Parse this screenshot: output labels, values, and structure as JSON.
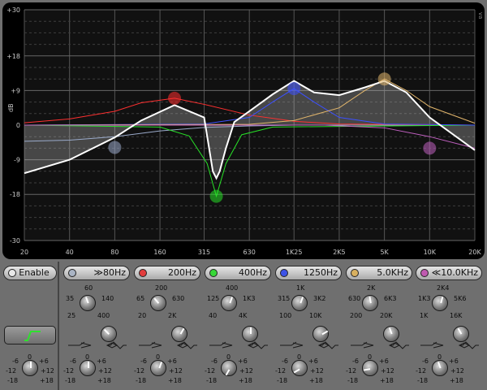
{
  "graph": {
    "y_labels": [
      "+30",
      "+18",
      "+9",
      "dB",
      "0",
      "-9",
      "-18",
      "-30"
    ],
    "x_labels": [
      "20",
      "40",
      "80",
      "160",
      "315",
      "630",
      "1K25",
      "2K5",
      "5K",
      "10K",
      "20K"
    ],
    "corner_label": "va"
  },
  "enable": {
    "label": "Enable"
  },
  "bands": [
    {
      "name": "band-1",
      "led": "#aab4c4",
      "label": "≫80Hz",
      "freq_ticks": [
        "25",
        "35",
        "60",
        "140",
        "400"
      ],
      "selected": "low-shelf"
    },
    {
      "name": "band-2",
      "led": "#e23c3c",
      "label": "200Hz",
      "freq_ticks": [
        "20",
        "65",
        "200",
        "630",
        "2K"
      ],
      "selected": "peak"
    },
    {
      "name": "band-3",
      "led": "#38d838",
      "label": "400Hz",
      "freq_ticks": [
        "40",
        "125",
        "400",
        "1K3",
        "4K"
      ],
      "selected": "peak"
    },
    {
      "name": "band-4",
      "led": "#3c52e6",
      "label": "1250Hz",
      "freq_ticks": [
        "100",
        "315",
        "1K",
        "3K2",
        "10K"
      ],
      "selected": "peak"
    },
    {
      "name": "band-5",
      "led": "#d8b060",
      "label": "5.0KHz",
      "freq_ticks": [
        "200",
        "630",
        "2K",
        "6K3",
        "20K"
      ],
      "selected": "peak"
    },
    {
      "name": "band-6",
      "led": "#c05ab0",
      "label": "≪10.0KHz",
      "freq_ticks": [
        "1K",
        "1K3",
        "2K4",
        "5K6",
        "16K"
      ],
      "selected": "high-shelf"
    }
  ],
  "gain_ticks": [
    "-6",
    "0",
    "+6",
    "-12",
    "+12",
    "-18",
    "+18"
  ],
  "master_gain_ticks": [
    "-6",
    "0",
    "+6",
    "-12",
    "+12",
    "-18",
    "+18"
  ],
  "chart_data": {
    "type": "line",
    "x_ticks": [
      "20",
      "40",
      "80",
      "160",
      "315",
      "630",
      "1K25",
      "2K5",
      "5K",
      "10K",
      "20K"
    ],
    "y_ticks": [
      "+30",
      "+18",
      "+9",
      "0",
      "-9",
      "-18",
      "-30"
    ],
    "y_unit": "dB",
    "xlim_hz": [
      20,
      20000
    ],
    "ylim_db": [
      -30,
      30
    ],
    "x_scale": "log",
    "grid": true,
    "series": [
      {
        "color": "#9aaaca",
        "points": [
          [
            20,
            -4.2
          ],
          [
            40,
            -3.9
          ],
          [
            80,
            -3.0
          ],
          [
            160,
            -1.5
          ],
          [
            315,
            -0.6
          ],
          [
            630,
            -0.2
          ],
          [
            1250,
            0
          ],
          [
            20000,
            0
          ]
        ],
        "handle": [
          80,
          -5.8
        ]
      },
      {
        "color": "#ff3030",
        "points": [
          [
            20,
            0.6
          ],
          [
            40,
            1.6
          ],
          [
            80,
            3.6
          ],
          [
            120,
            5.8
          ],
          [
            200,
            7.0
          ],
          [
            315,
            5.4
          ],
          [
            630,
            2.6
          ],
          [
            1250,
            1.0
          ],
          [
            2500,
            0.3
          ],
          [
            20000,
            0
          ]
        ],
        "handle": [
          200,
          7.0
        ]
      },
      {
        "color": "#28e028",
        "points": [
          [
            20,
            0
          ],
          [
            160,
            -0.5
          ],
          [
            250,
            -2.8
          ],
          [
            330,
            -10
          ],
          [
            380,
            -18.5
          ],
          [
            440,
            -10
          ],
          [
            560,
            -2.5
          ],
          [
            900,
            -0.5
          ],
          [
            20000,
            0
          ]
        ],
        "handle": [
          380,
          -18.5
        ]
      },
      {
        "color": "#3c50ff",
        "points": [
          [
            20,
            0
          ],
          [
            315,
            0.3
          ],
          [
            630,
            2.0
          ],
          [
            900,
            6.0
          ],
          [
            1250,
            9.5
          ],
          [
            1700,
            6.0
          ],
          [
            2500,
            2.0
          ],
          [
            5000,
            0.3
          ],
          [
            20000,
            0
          ]
        ],
        "handle": [
          1250,
          9.5
        ]
      },
      {
        "color": "#e2b66c",
        "points": [
          [
            20,
            0
          ],
          [
            630,
            0.2
          ],
          [
            1250,
            1.2
          ],
          [
            2500,
            4.5
          ],
          [
            3700,
            9.0
          ],
          [
            5000,
            12.0
          ],
          [
            7000,
            9.0
          ],
          [
            10000,
            4.8
          ],
          [
            20000,
            0.5
          ]
        ],
        "handle": [
          5000,
          12.0
        ]
      },
      {
        "color": "#c060c0",
        "points": [
          [
            20,
            0
          ],
          [
            2000,
            0
          ],
          [
            5000,
            -0.7
          ],
          [
            10000,
            -3.0
          ],
          [
            20000,
            -6.0
          ]
        ],
        "handle": [
          10000,
          -6.0
        ]
      },
      {
        "color": "#ffffff",
        "name": "sum",
        "points": [
          [
            20,
            -12.5
          ],
          [
            40,
            -9.0
          ],
          [
            80,
            -3.2
          ],
          [
            120,
            1.2
          ],
          [
            200,
            5.2
          ],
          [
            315,
            2.0
          ],
          [
            340,
            -6
          ],
          [
            360,
            -12
          ],
          [
            380,
            -13.8
          ],
          [
            400,
            -12
          ],
          [
            440,
            -6
          ],
          [
            500,
            0.8
          ],
          [
            630,
            3.6
          ],
          [
            900,
            8.0
          ],
          [
            1250,
            11.5
          ],
          [
            1700,
            8.5
          ],
          [
            2500,
            7.8
          ],
          [
            3700,
            9.8
          ],
          [
            5000,
            11.5
          ],
          [
            7000,
            8.5
          ],
          [
            10000,
            2.0
          ],
          [
            20000,
            -6.5
          ]
        ]
      }
    ]
  }
}
